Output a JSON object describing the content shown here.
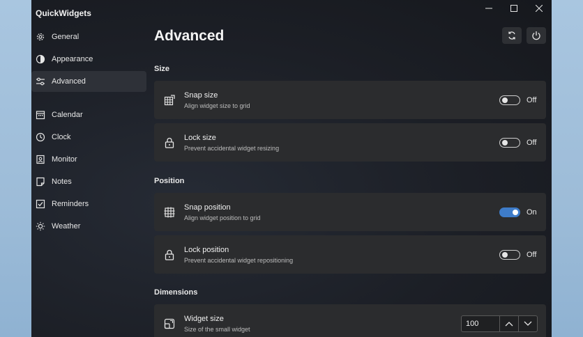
{
  "app": {
    "title": "QuickWidgets"
  },
  "sidebar": {
    "items": [
      {
        "label": "General",
        "icon": "gear-icon"
      },
      {
        "label": "Appearance",
        "icon": "contrast-icon"
      },
      {
        "label": "Advanced",
        "icon": "sliders-icon",
        "active": true
      },
      {
        "label": "Calendar",
        "icon": "calendar-icon"
      },
      {
        "label": "Clock",
        "icon": "clock-icon"
      },
      {
        "label": "Monitor",
        "icon": "monitor-icon"
      },
      {
        "label": "Notes",
        "icon": "note-icon"
      },
      {
        "label": "Reminders",
        "icon": "checkbox-icon"
      },
      {
        "label": "Weather",
        "icon": "sun-icon"
      }
    ]
  },
  "main": {
    "title": "Advanced",
    "sections": [
      {
        "label": "Size",
        "cards": [
          {
            "title": "Snap size",
            "subtitle": "Align widget size to grid",
            "state": "Off"
          },
          {
            "title": "Lock size",
            "subtitle": "Prevent accidental widget resizing",
            "state": "Off"
          }
        ]
      },
      {
        "label": "Position",
        "cards": [
          {
            "title": "Snap position",
            "subtitle": "Align widget position to grid",
            "state": "On"
          },
          {
            "title": "Lock position",
            "subtitle": "Prevent accidental widget repositioning",
            "state": "Off"
          }
        ]
      },
      {
        "label": "Dimensions",
        "cards": [
          {
            "title": "Widget size",
            "subtitle": "Size of the small widget",
            "value": "100"
          }
        ]
      }
    ]
  },
  "colors": {
    "accent": "#3e7cc9",
    "card": "#2b2c2e",
    "window": "#1c1f26"
  }
}
